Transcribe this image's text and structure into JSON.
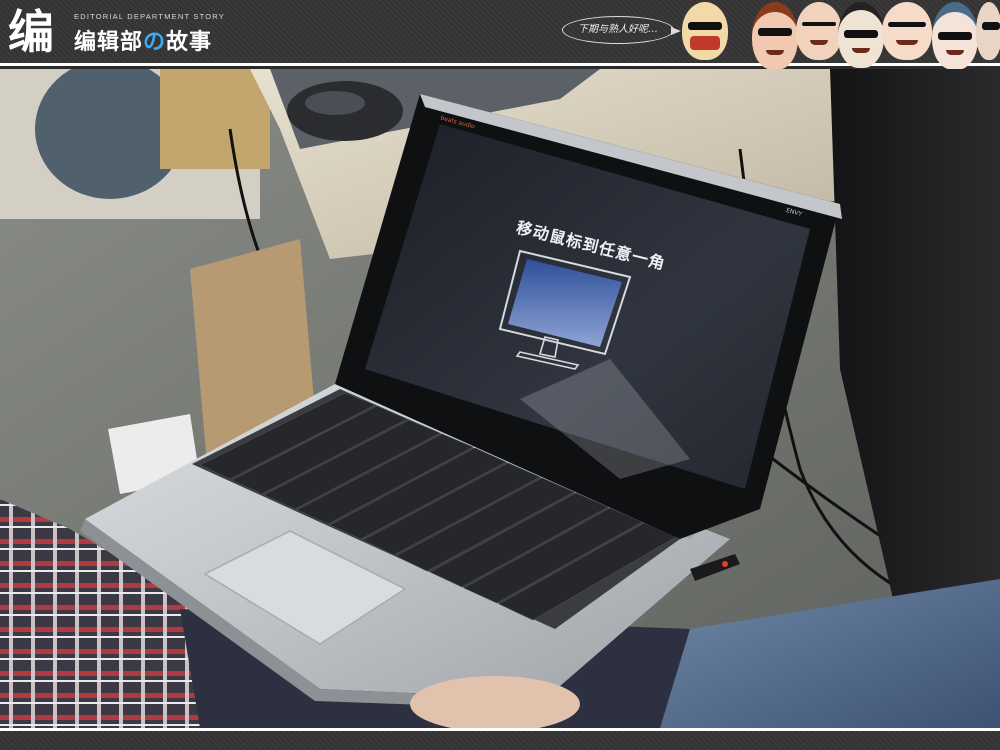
{
  "banner": {
    "logo_glyph": "编",
    "subtitle": "EDITORIAL DEPARTMENT STORY",
    "title_part1": "编辑部",
    "title_part2": "の",
    "title_part3": "故事",
    "speech_bubble": "下期与熟人好呢…",
    "caricatures": [
      "face-1",
      "face-2",
      "face-3",
      "face-4",
      "face-5",
      "face-6",
      "face-7"
    ]
  },
  "photo": {
    "screen": {
      "brand_left": "beats audio",
      "brand_right": "ENVY",
      "message": "移动鼠标到任意一角"
    },
    "colors": {
      "screen_bg": "#262a33",
      "monitor_blue": "#3d5da8",
      "chassis": "#c9ccd0",
      "keys": "#2f3136",
      "power_led": "#e0402a"
    }
  }
}
